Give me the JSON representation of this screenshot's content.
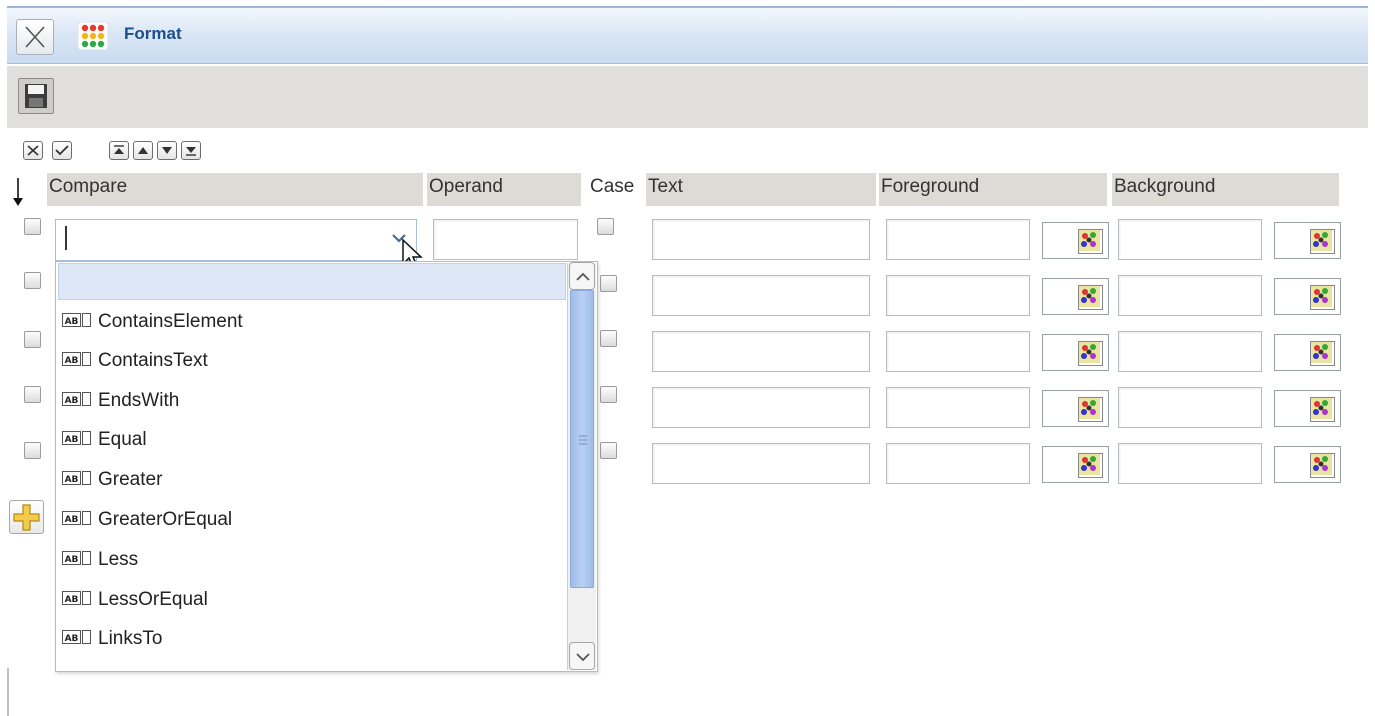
{
  "window": {
    "title": "Format"
  },
  "columns": {
    "compare": "Compare",
    "operand": "Operand",
    "case": "Case",
    "text": "Text",
    "foreground": "Foreground",
    "background": "Background"
  },
  "compare_input": {
    "value": ""
  },
  "dropdown": {
    "selected_index": 0,
    "items": [
      "ContainsElement",
      "ContainsText",
      "EndsWith",
      "Equal",
      "Greater",
      "GreaterOrEqual",
      "Less",
      "LessOrEqual",
      "LinksTo"
    ]
  },
  "icons": {
    "close": "close-icon",
    "app": "format-grid-icon",
    "save": "save-disk-icon",
    "clear": "x-icon",
    "apply": "check-icon",
    "move_top": "move-top-icon",
    "move_up": "move-up-icon",
    "move_down": "move-down-icon",
    "move_bottom": "move-bottom-icon",
    "sort": "sort-arrow-icon",
    "add": "plus-icon",
    "color_picker": "color-palette-icon",
    "item_type": "ab-text-type-icon"
  },
  "colors": {
    "title_text": "#1d4f8c",
    "titlebar_bg": "#c9dbf0",
    "header_bg": "#dedad5",
    "selected_item_bg": "#dde7f6",
    "scroll_thumb": "#a9c4ee",
    "add_icon": "#f2cc4a"
  }
}
